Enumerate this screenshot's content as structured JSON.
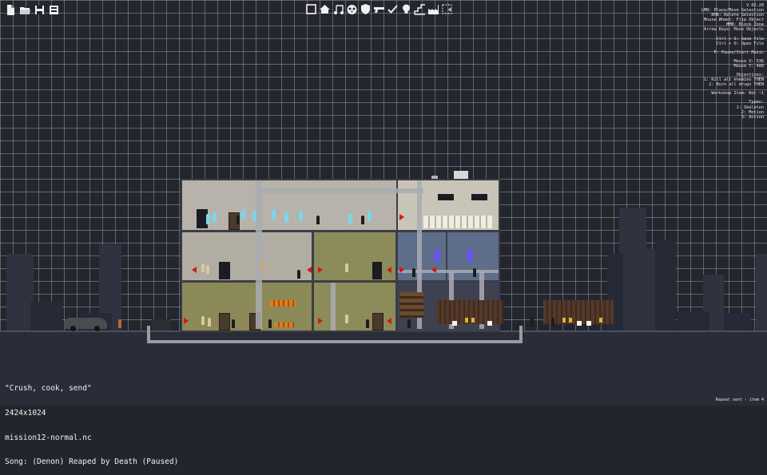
{
  "file_toolbar": {
    "items": [
      {
        "name": "new-file-icon",
        "glyph": "🗋"
      },
      {
        "name": "open-folder-icon",
        "glyph": "🗁"
      },
      {
        "name": "save-icon",
        "glyph": "🖫"
      },
      {
        "name": "save-as-icon",
        "glyph": "🖫"
      }
    ]
  },
  "tool_toolbar": {
    "items": [
      {
        "name": "rectangle-tool-icon"
      },
      {
        "name": "home-tool-icon"
      },
      {
        "name": "music-note-icon"
      },
      {
        "name": "panda-icon"
      },
      {
        "name": "shield-icon"
      },
      {
        "name": "gun-icon"
      },
      {
        "name": "checkmark-icon"
      },
      {
        "name": "lightbulb-icon"
      },
      {
        "name": "stairs-icon"
      },
      {
        "name": "factory-icon"
      },
      {
        "name": "selection-tool-icon"
      }
    ]
  },
  "help_panel": {
    "version": "V.02.20",
    "lines": [
      "LMB: Place/Move Selection",
      "RMB: Delete Selection",
      "Mouse Wheel: Flip Object",
      "MMB: Block Zone",
      "Arrow Keys: Move Objects",
      "",
      "Ctrl + S: Save file",
      "Ctrl + O: Open File",
      "",
      "P: Pause/Start Music",
      "",
      "Mouse X: 536",
      "Mouse Y: 400",
      "",
      "Objectives:",
      "1: Kill all enemies THEN",
      "2: Burn all drugs THEN",
      "",
      "Workshop Item: Not ~1",
      "",
      "Types:",
      "1: Skeleton",
      "2: Motion",
      "3: Action"
    ]
  },
  "map_info": {
    "name": "\"Crush, cook, send\"",
    "size": "2424x1024",
    "file": "mission12-normal.nc",
    "song": "Song: (Denon) Reaped by Death (Paused)"
  },
  "status": {
    "text": "Repeat sent - item 4"
  },
  "colors": {
    "background": "#24262e",
    "grid": "#9698a0",
    "enemy_marker": "#d11818",
    "ghost": "#7fd4e8",
    "wall": "#3b3d47"
  }
}
